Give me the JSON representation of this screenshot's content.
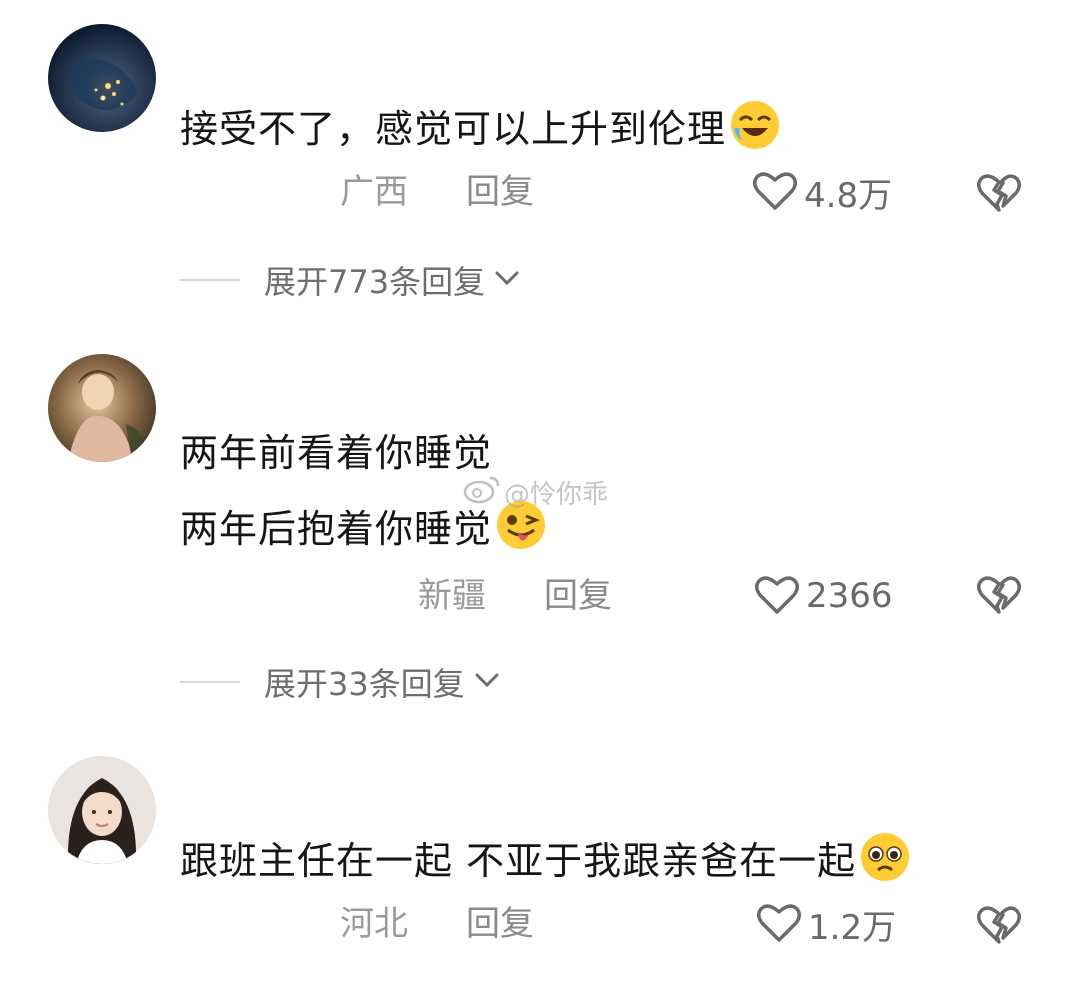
{
  "comments": [
    {
      "text_lines": [
        "接受不了，感觉可以上升到伦理"
      ],
      "emoji": "rolling-laughing-emoji",
      "location": "广西",
      "reply_label": "回复",
      "likes": "4.8万",
      "expand_label": "展开773条回复"
    },
    {
      "text_lines": [
        "两年前看着你睡觉",
        "两年后抱着你睡觉"
      ],
      "emoji": "winking-tongue-emoji",
      "location": "新疆",
      "reply_label": "回复",
      "likes": "2366",
      "expand_label": "展开33条回复"
    },
    {
      "text_lines": [
        "跟班主任在一起 不亚于我跟亲爸在一起"
      ],
      "emoji": "pleading-face-emoji",
      "location": "河北",
      "reply_label": "回复",
      "likes": "1.2万"
    }
  ],
  "watermark": "@怜你乖",
  "icons": {
    "like": "heart-outline-icon",
    "dislike": "broken-heart-icon",
    "expand": "chevron-down-icon",
    "watermark": "weibo-logo-icon"
  },
  "colors": {
    "text": "#161616",
    "meta": "#9a9a9a",
    "count": "#6a6a6a"
  }
}
